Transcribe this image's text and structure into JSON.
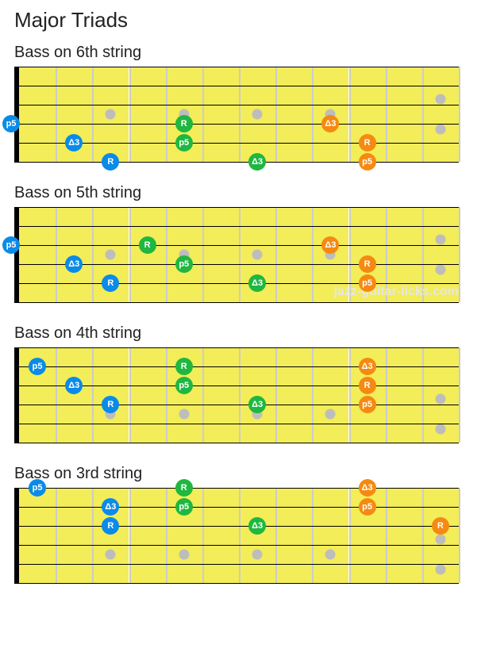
{
  "page_title": "Major Triads",
  "watermark": "jazz-guitar-licks.com",
  "colors": {
    "blue": "#0a8be8",
    "green": "#1fb740",
    "orange": "#f58a12",
    "marker": "#bdbdbd"
  },
  "fretboard": {
    "num_frets": 12,
    "num_strings": 6,
    "inlay_frets": [
      3,
      5,
      7,
      9,
      12
    ]
  },
  "diagrams": [
    {
      "title": "Bass   on 6th string",
      "inlay_row_between": [
        3,
        4
      ],
      "watermark": false,
      "notes": [
        {
          "string": 4,
          "fret": 0,
          "label": "p5",
          "color": "blue"
        },
        {
          "string": 5,
          "fret": 2,
          "label": "Δ3",
          "color": "blue"
        },
        {
          "string": 6,
          "fret": 3,
          "label": "R",
          "color": "blue"
        },
        {
          "string": 4,
          "fret": 5,
          "label": "R",
          "color": "green"
        },
        {
          "string": 5,
          "fret": 5,
          "label": "p5",
          "color": "green"
        },
        {
          "string": 6,
          "fret": 7,
          "label": "Δ3",
          "color": "green"
        },
        {
          "string": 4,
          "fret": 9,
          "label": "Δ3",
          "color": "orange"
        },
        {
          "string": 5,
          "fret": 10,
          "label": "R",
          "color": "orange"
        },
        {
          "string": 6,
          "fret": 10,
          "label": "p5",
          "color": "orange"
        }
      ]
    },
    {
      "title": "Bass   on 5th string",
      "inlay_row_between": [
        3,
        4
      ],
      "watermark": true,
      "notes": [
        {
          "string": 3,
          "fret": 0,
          "label": "p5",
          "color": "blue"
        },
        {
          "string": 4,
          "fret": 2,
          "label": "Δ3",
          "color": "blue"
        },
        {
          "string": 5,
          "fret": 3,
          "label": "R",
          "color": "blue"
        },
        {
          "string": 3,
          "fret": 4,
          "label": "R",
          "color": "green"
        },
        {
          "string": 4,
          "fret": 5,
          "label": "p5",
          "color": "green"
        },
        {
          "string": 5,
          "fret": 7,
          "label": "Δ3",
          "color": "green"
        },
        {
          "string": 3,
          "fret": 9,
          "label": "Δ3",
          "color": "orange"
        },
        {
          "string": 4,
          "fret": 10,
          "label": "R",
          "color": "orange"
        },
        {
          "string": 5,
          "fret": 10,
          "label": "p5",
          "color": "orange"
        }
      ]
    },
    {
      "title": "Bass   on 4th string",
      "inlay_row_between": [
        4,
        5
      ],
      "watermark": false,
      "notes": [
        {
          "string": 2,
          "fret": 1,
          "label": "p5",
          "color": "blue"
        },
        {
          "string": 3,
          "fret": 2,
          "label": "Δ3",
          "color": "blue"
        },
        {
          "string": 4,
          "fret": 3,
          "label": "R",
          "color": "blue"
        },
        {
          "string": 2,
          "fret": 5,
          "label": "R",
          "color": "green"
        },
        {
          "string": 3,
          "fret": 5,
          "label": "p5",
          "color": "green"
        },
        {
          "string": 4,
          "fret": 7,
          "label": "Δ3",
          "color": "green"
        },
        {
          "string": 2,
          "fret": 10,
          "label": "Δ3",
          "color": "orange"
        },
        {
          "string": 3,
          "fret": 10,
          "label": "R",
          "color": "orange"
        },
        {
          "string": 4,
          "fret": 10,
          "label": "p5",
          "color": "orange"
        }
      ]
    },
    {
      "title": "Bass   on 3rd string",
      "inlay_row_between": [
        4,
        5
      ],
      "watermark": false,
      "notes": [
        {
          "string": 1,
          "fret": 1,
          "label": "p5",
          "color": "blue"
        },
        {
          "string": 2,
          "fret": 3,
          "label": "Δ3",
          "color": "blue"
        },
        {
          "string": 3,
          "fret": 3,
          "label": "R",
          "color": "blue"
        },
        {
          "string": 1,
          "fret": 5,
          "label": "R",
          "color": "green"
        },
        {
          "string": 2,
          "fret": 5,
          "label": "p5",
          "color": "green"
        },
        {
          "string": 3,
          "fret": 7,
          "label": "Δ3",
          "color": "green"
        },
        {
          "string": 1,
          "fret": 10,
          "label": "Δ3",
          "color": "orange"
        },
        {
          "string": 2,
          "fret": 10,
          "label": "p5",
          "color": "orange"
        },
        {
          "string": 3,
          "fret": 12,
          "label": "R",
          "color": "orange"
        }
      ]
    }
  ]
}
